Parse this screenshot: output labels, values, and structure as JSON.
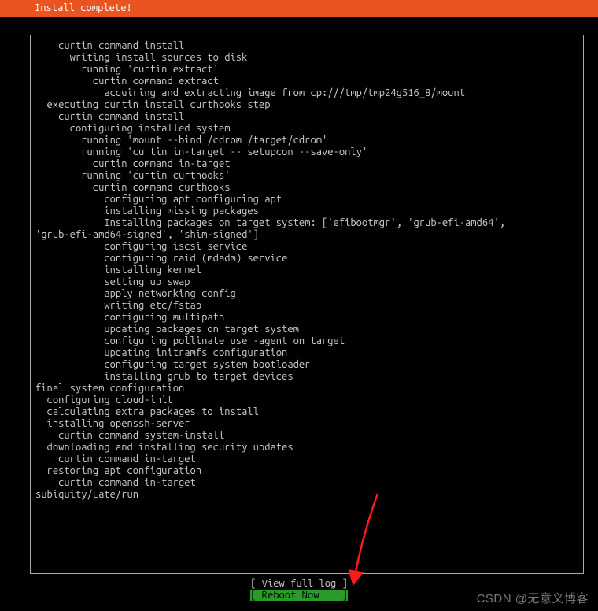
{
  "header": {
    "title": "Install complete!"
  },
  "log": {
    "lines": [
      "    curtin command install",
      "      writing install sources to disk",
      "        running 'curtin extract'",
      "          curtin command extract",
      "            acquiring and extracting image from cp:///tmp/tmp24g516_8/mount",
      "  executing curtin install curthooks step",
      "    curtin command install",
      "      configuring installed system",
      "        running 'mount --bind /cdrom /target/cdrom'",
      "        running 'curtin in-target -- setupcon --save-only'",
      "          curtin command in-target",
      "        running 'curtin curthooks'",
      "          curtin command curthooks",
      "            configuring apt configuring apt",
      "            installing missing packages",
      "            Installing packages on target system: ['efibootmgr', 'grub-efi-amd64',",
      "'grub-efi-amd64-signed', 'shim-signed']",
      "            configuring iscsi service",
      "            configuring raid (mdadm) service",
      "            installing kernel",
      "            setting up swap",
      "            apply networking config",
      "            writing etc/fstab",
      "            configuring multipath",
      "            updating packages on target system",
      "            configuring pollinate user-agent on target",
      "            updating initramfs configuration",
      "            configuring target system bootloader",
      "            installing grub to target devices",
      "final system configuration",
      "  configuring cloud-init",
      "  calculating extra packages to install",
      "  installing openssh-server",
      "    curtin command system-install",
      "  downloading and installing security updates",
      "    curtin command in-target",
      "  restoring apt configuration",
      "    curtin command in-target",
      "subiquity/Late/run"
    ]
  },
  "buttons": {
    "view_log": "View full log",
    "reboot": "Reboot Now"
  },
  "watermark": "CSDN @无意义博客",
  "colors": {
    "accent": "#e95420",
    "active_bg": "#2a9b2a"
  }
}
